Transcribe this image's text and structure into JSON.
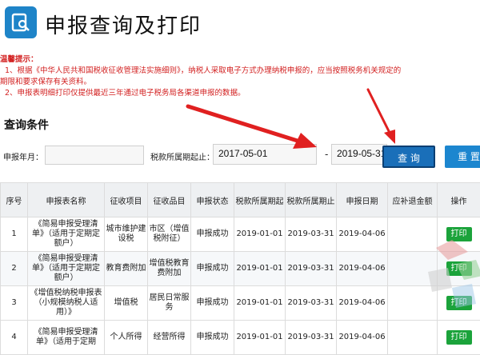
{
  "header": {
    "title": "申报查询及打印",
    "logo_icon": "search-document-icon",
    "accent": "#1e84c8"
  },
  "notice": {
    "heading": "温馨提示：",
    "line1": "1、根据《中华人民共和国税收征收管理法实施细则》，纳税人采取电子方式办理纳税申报的，应当按照税务机关规定的",
    "line1b": "期限和要求保存有关资料。",
    "line2": "2、申报表明细打印仅提供最近三年通过电子税务局各渠道申报的数据。"
  },
  "query": {
    "section_title": "查询条件",
    "year_label": "申报年月：",
    "year_value": "",
    "period_label": "税款所属期起止：",
    "period_start": "2017-05-01",
    "dash": "-",
    "period_end": "2019-05-31",
    "query_button": "查 询",
    "reset_button": "重 置"
  },
  "table": {
    "headers": [
      "序号",
      "申报表名称",
      "征收项目",
      "征收品目",
      "申报状态",
      "税款所属期起",
      "税款所属期止",
      "申报日期",
      "应补退金额",
      "操作"
    ],
    "rows": [
      {
        "no": "1",
        "name": "《简易申报受理清单》（适用于定期定额户）",
        "item": "城市维护建设税",
        "sub": "市区（增值税附征）",
        "status": "申报成功",
        "start": "2019-01-01",
        "end": "2019-03-31",
        "date": "2019-04-06",
        "amount": "",
        "op": "打印"
      },
      {
        "no": "2",
        "name": "《简易申报受理清单》（适用于定期定额户）",
        "item": "教育费附加",
        "sub": "增值税教育费附加",
        "status": "申报成功",
        "start": "2019-01-01",
        "end": "2019-03-31",
        "date": "2019-04-06",
        "amount": "",
        "op": "打印"
      },
      {
        "no": "3",
        "name": "《增值税纳税申报表（小规模纳税人适用）》",
        "item": "增值税",
        "sub": "居民日常服务",
        "status": "申报成功",
        "start": "2019-01-01",
        "end": "2019-03-31",
        "date": "2019-04-06",
        "amount": "",
        "op": "打印"
      },
      {
        "no": "4",
        "name": "《简易申报受理清单》（适用于定期",
        "item": "个人所得",
        "sub": "经营所得",
        "status": "申报成功",
        "start": "2019-01-01",
        "end": "2019-03-31",
        "date": "2019-04-06",
        "amount": "",
        "op": "打印"
      }
    ]
  }
}
